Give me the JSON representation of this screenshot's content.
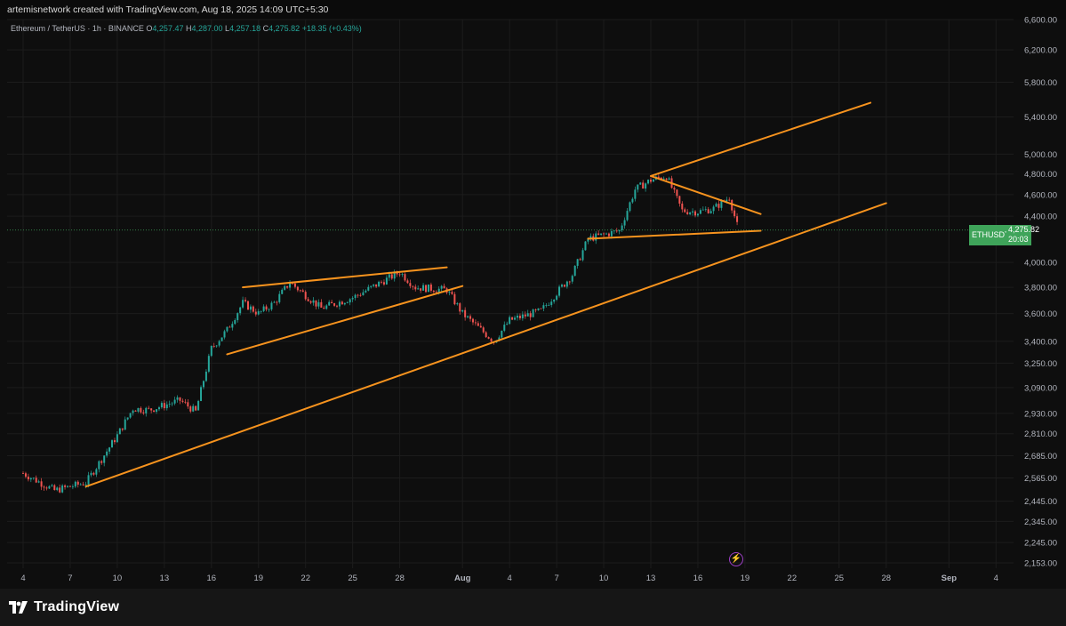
{
  "header": {
    "attribution": "artemisnetwork created with TradingView.com, Aug 18, 2025 14:09 UTC+5:30"
  },
  "legend": {
    "title": "Ethereum / TetherUS · 1h · BINANCE",
    "o_key": "O",
    "o_val": "4,257.47",
    "h_key": "H",
    "h_val": "4,287.00",
    "l_key": "L",
    "l_val": "4,257.18",
    "c_key": "C",
    "c_val": "4,275.82",
    "change": "+18.35 (+0.43%)"
  },
  "price_badge": {
    "symbol": "ETHUSDT",
    "price": "4,275.82",
    "countdown": "20:03"
  },
  "footer": {
    "brand": "TradingView"
  },
  "colors": {
    "up": "#26a69a",
    "down": "#ef5350",
    "trendline": "#f7931e",
    "badge": "#3fa45a",
    "background": "#0e0e0e"
  },
  "icons": [
    "tradingview-logo-icon",
    "lightning-icon"
  ],
  "chart_data": {
    "type": "candlestick",
    "title": "Ethereum / TetherUS · 1h · BINANCE",
    "y_scale": "log",
    "y_ticks": [
      "6,600.00",
      "6,200.00",
      "5,800.00",
      "5,400.00",
      "5,000.00",
      "4,800.00",
      "4,600.00",
      "4,400.00",
      "4,000.00",
      "3,800.00",
      "3,600.00",
      "3,400.00",
      "3,250.00",
      "3,090.00",
      "2,930.00",
      "2,810.00",
      "2,685.00",
      "2,565.00",
      "2,445.00",
      "2,345.00",
      "2,245.00",
      "2,153.00"
    ],
    "x_ticks": [
      "4",
      "7",
      "10",
      "13",
      "16",
      "19",
      "22",
      "25",
      "28",
      "Aug",
      "4",
      "7",
      "10",
      "13",
      "16",
      "19",
      "22",
      "25",
      "28",
      "Sep",
      "4"
    ],
    "ylim": [
      2153,
      6600
    ],
    "last_price": 4275.82,
    "price_path_approx": [
      {
        "x": "2025-07-04",
        "y": 2590
      },
      {
        "x": "2025-07-06",
        "y": 2500
      },
      {
        "x": "2025-07-08",
        "y": 2540
      },
      {
        "x": "2025-07-10",
        "y": 2800
      },
      {
        "x": "2025-07-11",
        "y": 2960
      },
      {
        "x": "2025-07-12",
        "y": 2950
      },
      {
        "x": "2025-07-14",
        "y": 3010
      },
      {
        "x": "2025-07-15",
        "y": 2940
      },
      {
        "x": "2025-07-16",
        "y": 3350
      },
      {
        "x": "2025-07-17",
        "y": 3480
      },
      {
        "x": "2025-07-18",
        "y": 3680
      },
      {
        "x": "2025-07-19",
        "y": 3600
      },
      {
        "x": "2025-07-20",
        "y": 3680
      },
      {
        "x": "2025-07-21",
        "y": 3840
      },
      {
        "x": "2025-07-23",
        "y": 3640
      },
      {
        "x": "2025-07-25",
        "y": 3720
      },
      {
        "x": "2025-07-28",
        "y": 3920
      },
      {
        "x": "2025-07-29",
        "y": 3800
      },
      {
        "x": "2025-07-31",
        "y": 3780
      },
      {
        "x": "2025-08-01",
        "y": 3600
      },
      {
        "x": "2025-08-03",
        "y": 3400
      },
      {
        "x": "2025-08-04",
        "y": 3550
      },
      {
        "x": "2025-08-06",
        "y": 3620
      },
      {
        "x": "2025-08-08",
        "y": 3900
      },
      {
        "x": "2025-08-09",
        "y": 4200
      },
      {
        "x": "2025-08-11",
        "y": 4270
      },
      {
        "x": "2025-08-12",
        "y": 4650
      },
      {
        "x": "2025-08-13",
        "y": 4740
      },
      {
        "x": "2025-08-14",
        "y": 4780
      },
      {
        "x": "2025-08-15",
        "y": 4450
      },
      {
        "x": "2025-08-16",
        "y": 4440
      },
      {
        "x": "2025-08-17",
        "y": 4470
      },
      {
        "x": "2025-08-18",
        "y": 4575
      },
      {
        "x": "2025-08-18 14:00",
        "y": 4275.82
      }
    ],
    "trendlines": [
      {
        "from": {
          "x": "2025-08-13",
          "y": 4780
        },
        "to": {
          "x": "2025-08-27",
          "y": 5560
        }
      },
      {
        "from": {
          "x": "2025-07-08",
          "y": 2520
        },
        "to": {
          "x": "2025-08-28",
          "y": 4520
        }
      },
      {
        "from": {
          "x": "2025-07-18",
          "y": 3800
        },
        "to": {
          "x": "2025-07-31",
          "y": 3960
        }
      },
      {
        "from": {
          "x": "2025-07-17",
          "y": 3310
        },
        "to": {
          "x": "2025-08-01",
          "y": 3810
        }
      },
      {
        "from": {
          "x": "2025-08-13",
          "y": 4780
        },
        "to": {
          "x": "2025-08-20",
          "y": 4420
        }
      },
      {
        "from": {
          "x": "2025-08-09",
          "y": 4200
        },
        "to": {
          "x": "2025-08-20",
          "y": 4270
        }
      }
    ]
  }
}
